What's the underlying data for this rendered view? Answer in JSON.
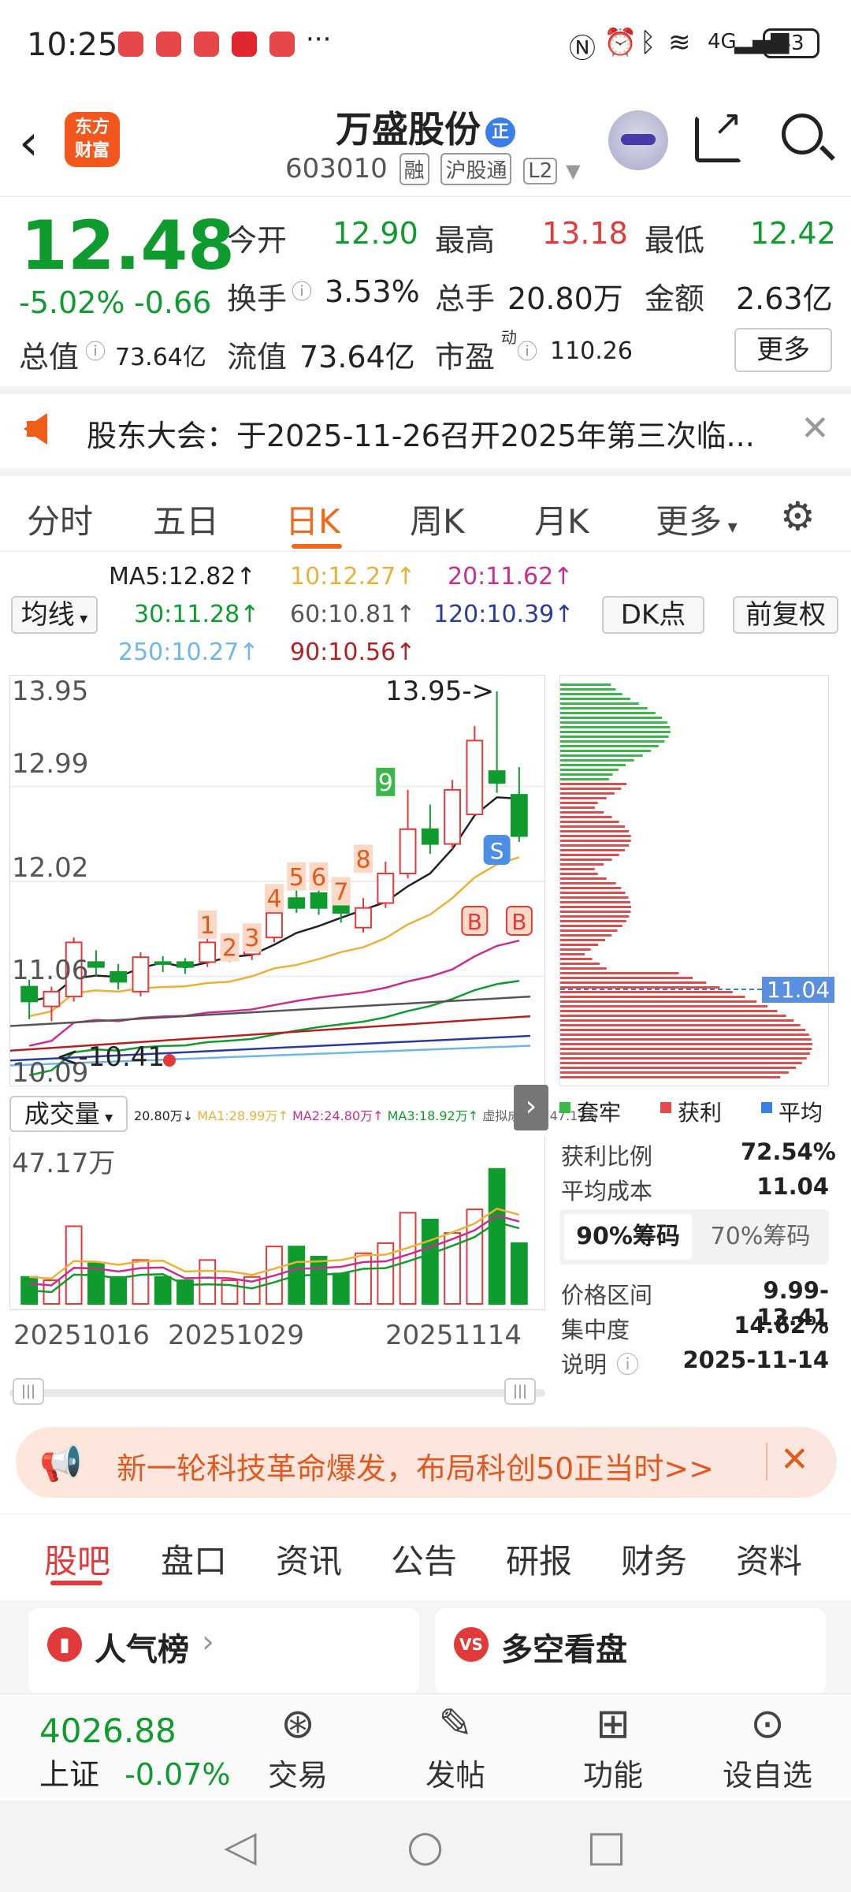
{
  "status_bar": {
    "time": "10:25",
    "more": "···",
    "network": "4G",
    "battery": "43"
  },
  "header": {
    "logo_line1": "东方",
    "logo_line2": "财富",
    "name": "万盛股份",
    "name_badge": "正",
    "code": "603010",
    "tags": [
      "融",
      "沪股通",
      "L2"
    ]
  },
  "quote": {
    "price": "12.48",
    "change_pct": "-5.02%",
    "change_abs": "-0.66",
    "market_cap_label": "总值",
    "market_cap": "73.64亿",
    "float_cap_label": "流值",
    "float_cap": "73.64亿",
    "pe_label": "市盈",
    "pe_sup": "动",
    "pe": "110.26",
    "open_label": "今开",
    "open": "12.90",
    "high_label": "最高",
    "high": "13.18",
    "low_label": "最低",
    "low": "12.42",
    "turnover_label": "换手",
    "turnover": "3.53%",
    "volume_label": "总手",
    "volume": "20.80万",
    "amount_label": "金额",
    "amount": "2.63亿",
    "more_label": "更多"
  },
  "notice": {
    "text": "股东大会：于2025-11-26召开2025年第三次临..."
  },
  "period_tabs": [
    "分时",
    "五日",
    "日K",
    "周K",
    "月K",
    "更多"
  ],
  "period_active": "日K",
  "ma": {
    "ma_button": "均线",
    "ma5": "MA5:12.82↑",
    "ma10": "10:12.27↑",
    "ma20": "20:11.62↑",
    "ma30": "30:11.28↑",
    "ma60": "60:10.81↑",
    "ma120": "120:10.39↑",
    "ma250": "250:10.27↑",
    "ma90": "90:10.56↑",
    "dk_button": "DK点",
    "fq_button": "前复权"
  },
  "kchart": {
    "y_labels": [
      "13.95",
      "12.99",
      "12.02",
      "11.06",
      "10.09"
    ],
    "high_marker": "13.95->",
    "low_marker": "<-10.41",
    "td_numbers": [
      "1",
      "2",
      "3",
      "4",
      "5",
      "6",
      "7",
      "8",
      "9"
    ],
    "signal_s": "S",
    "signal_b": "B",
    "watermark": "东方财富"
  },
  "chart_data": {
    "type": "candlestick",
    "candles": [
      {
        "o": 10.95,
        "c": 10.8,
        "h": 11.02,
        "l": 10.62
      },
      {
        "o": 10.75,
        "c": 10.9,
        "h": 10.95,
        "l": 10.6
      },
      {
        "o": 10.85,
        "c": 11.4,
        "h": 11.45,
        "l": 10.8
      },
      {
        "o": 11.2,
        "c": 11.15,
        "h": 11.32,
        "l": 11.05
      },
      {
        "o": 11.1,
        "c": 11.0,
        "h": 11.18,
        "l": 10.92
      },
      {
        "o": 10.9,
        "c": 11.25,
        "h": 11.3,
        "l": 10.85
      },
      {
        "o": 11.2,
        "c": 11.18,
        "h": 11.26,
        "l": 11.1
      },
      {
        "o": 11.2,
        "c": 11.15,
        "h": 11.24,
        "l": 11.08
      },
      {
        "o": 11.2,
        "c": 11.4,
        "h": 11.55,
        "l": 11.15
      },
      {
        "o": 11.25,
        "c": 11.28,
        "h": 11.4,
        "l": 11.2
      },
      {
        "o": 11.28,
        "c": 11.35,
        "h": 11.42,
        "l": 11.22
      },
      {
        "o": 11.45,
        "c": 11.7,
        "h": 11.95,
        "l": 11.4
      },
      {
        "o": 11.85,
        "c": 11.75,
        "h": 12.05,
        "l": 11.7
      },
      {
        "o": 11.9,
        "c": 11.75,
        "h": 12.0,
        "l": 11.68
      },
      {
        "o": 11.8,
        "c": 11.7,
        "h": 11.95,
        "l": 11.6
      },
      {
        "o": 11.55,
        "c": 11.75,
        "h": 11.85,
        "l": 11.5
      },
      {
        "o": 11.8,
        "c": 12.1,
        "h": 12.22,
        "l": 11.75
      },
      {
        "o": 12.1,
        "c": 12.55,
        "h": 12.95,
        "l": 12.05
      },
      {
        "o": 12.55,
        "c": 12.4,
        "h": 12.8,
        "l": 12.3
      },
      {
        "o": 12.4,
        "c": 12.95,
        "h": 13.05,
        "l": 12.35
      },
      {
        "o": 12.7,
        "c": 13.45,
        "h": 13.6,
        "l": 12.7
      },
      {
        "o": 13.14,
        "c": 13.02,
        "h": 13.95,
        "l": 12.92
      },
      {
        "o": 12.9,
        "c": 12.48,
        "h": 13.18,
        "l": 12.42
      }
    ],
    "ylim": [
      10.09,
      13.95
    ]
  },
  "chips": {
    "avg_cost_marker": "11.04",
    "legend": [
      "套牢",
      "获利",
      "平均"
    ],
    "profit_ratio_label": "获利比例",
    "profit_ratio": "72.54%",
    "avg_cost_label": "平均成本",
    "avg_cost": "11.04",
    "tab_90": "90%筹码",
    "tab_70": "70%筹码",
    "price_range_label": "价格区间",
    "price_range": "9.99-13.41",
    "concentration_label": "集中度",
    "concentration": "14.62%",
    "note_label": "说明",
    "note_date": "2025-11-14"
  },
  "volume": {
    "selector": "成交量",
    "summary": "20.80万↓",
    "ma1": "MA1:28.99万↑",
    "ma2": "MA2:24.80万↑",
    "ma3": "MA3:18.92万↑",
    "virtual": "虚拟成交量:47.17万",
    "y_max": "47.17万",
    "dates": [
      "20251016",
      "20251029",
      "20251114"
    ],
    "values": [
      8,
      7,
      23,
      12,
      8,
      13,
      8,
      7,
      13,
      7,
      8,
      17,
      17,
      14,
      9,
      15,
      18,
      27,
      25,
      21,
      28,
      40,
      18
    ]
  },
  "promo": {
    "text": "新一轮科技革命爆发，布局科创50正当时>>"
  },
  "sub_tabs": [
    "股吧",
    "盘口",
    "资讯",
    "公告",
    "研报",
    "财务",
    "资料"
  ],
  "cards": {
    "left_title": "人气榜",
    "right_title": "多空看盘"
  },
  "toolbar": {
    "index_value": "4026.88",
    "index_name": "上证",
    "index_change": "-0.07%",
    "items": [
      "交易",
      "发帖",
      "功能",
      "设自选"
    ]
  },
  "colors": {
    "up": "#e23a3a",
    "down": "#0f9b2e",
    "accent": "#ef6a1c"
  }
}
